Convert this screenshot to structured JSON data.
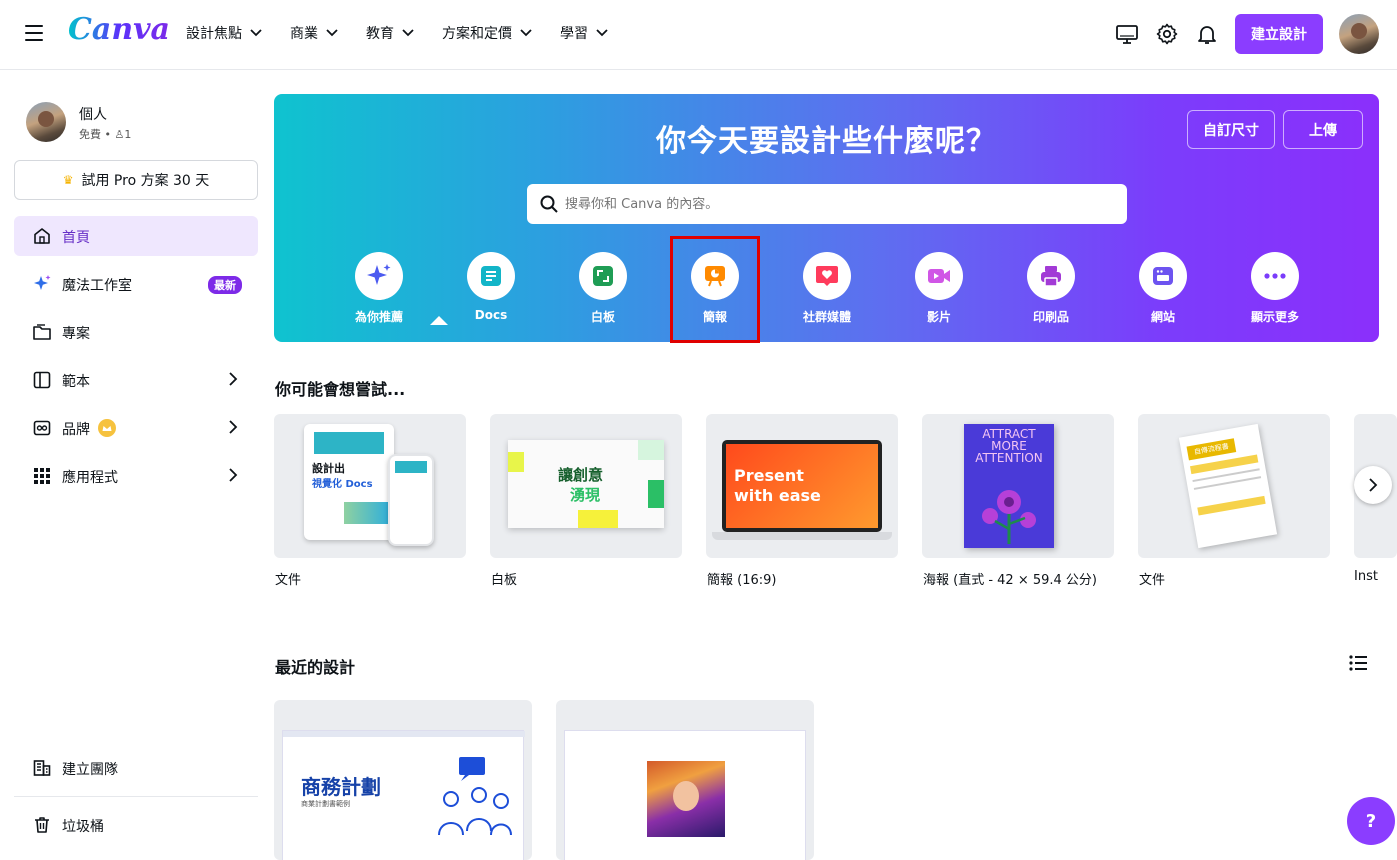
{
  "topbar": {
    "logo": "Canva",
    "nav": [
      {
        "label": "設計焦點"
      },
      {
        "label": "商業"
      },
      {
        "label": "教育"
      },
      {
        "label": "方案和定價"
      },
      {
        "label": "學習"
      }
    ],
    "create_label": "建立設計"
  },
  "sidebar": {
    "profile_name": "個人",
    "profile_plan": "免費 • ",
    "profile_members": "1",
    "pro_label": "試用 Pro 方案 30 天",
    "items": [
      {
        "label": "首頁",
        "icon": "home-icon",
        "active": true
      },
      {
        "label": "魔法工作室",
        "icon": "sparkle-icon",
        "badge": "最新"
      },
      {
        "label": "專案",
        "icon": "folder-icon"
      },
      {
        "label": "範本",
        "icon": "template-icon"
      },
      {
        "label": "品牌",
        "icon": "brand-icon"
      },
      {
        "label": "應用程式",
        "icon": "apps-grid-icon"
      }
    ],
    "team_label": "建立團隊",
    "trash_label": "垃圾桶"
  },
  "hero": {
    "title": "你今天要設計些什麼呢？",
    "custom_size_label": "自訂尺寸",
    "upload_label": "上傳",
    "search_placeholder": "搜尋你和 Canva 的內容。",
    "categories": [
      {
        "label": "為你推薦",
        "icon": "sparkle-icon",
        "color": "#4c5bf0"
      },
      {
        "label": "Docs",
        "icon": "docs-icon",
        "color": "#13b5c8"
      },
      {
        "label": "白板",
        "icon": "whiteboard-icon",
        "color": "#1f9d55"
      },
      {
        "label": "簡報",
        "icon": "presentation-icon",
        "color": "#ff8a00"
      },
      {
        "label": "社群媒體",
        "icon": "heart-icon",
        "color": "#ff3b5c"
      },
      {
        "label": "影片",
        "icon": "video-icon",
        "color": "#d056e6"
      },
      {
        "label": "印刷品",
        "icon": "printer-icon",
        "color": "#a23ad6"
      },
      {
        "label": "網站",
        "icon": "website-icon",
        "color": "#6d53f0"
      },
      {
        "label": "顯示更多",
        "icon": "more-icon",
        "color": "#7b3dfb"
      }
    ]
  },
  "suggestions": {
    "title": "你可能會想嘗試...",
    "cards": [
      {
        "label": "文件",
        "thumb_text": "設計出",
        "thumb_text2": "視覺化 Docs"
      },
      {
        "label": "白板",
        "thumb_text": "讓創意",
        "thumb_text2": "湧現"
      },
      {
        "label": "簡報 (16:9)",
        "thumb_text": "Present",
        "thumb_text2": "with ease"
      },
      {
        "label": "海報 (直式 - 42 × 59.4 公分)",
        "thumb_text": "ATTRACT MORE ATTENTION"
      },
      {
        "label": "文件",
        "thumb_text": "自傳流程書"
      },
      {
        "label": "Inst"
      }
    ]
  },
  "recent": {
    "title": "最近的設計",
    "items": [
      {
        "thumb_text": "商務計劃",
        "thumb_sub": "商業計劃書範例"
      },
      {
        "thumb_text": ""
      }
    ]
  },
  "help_label": "?"
}
